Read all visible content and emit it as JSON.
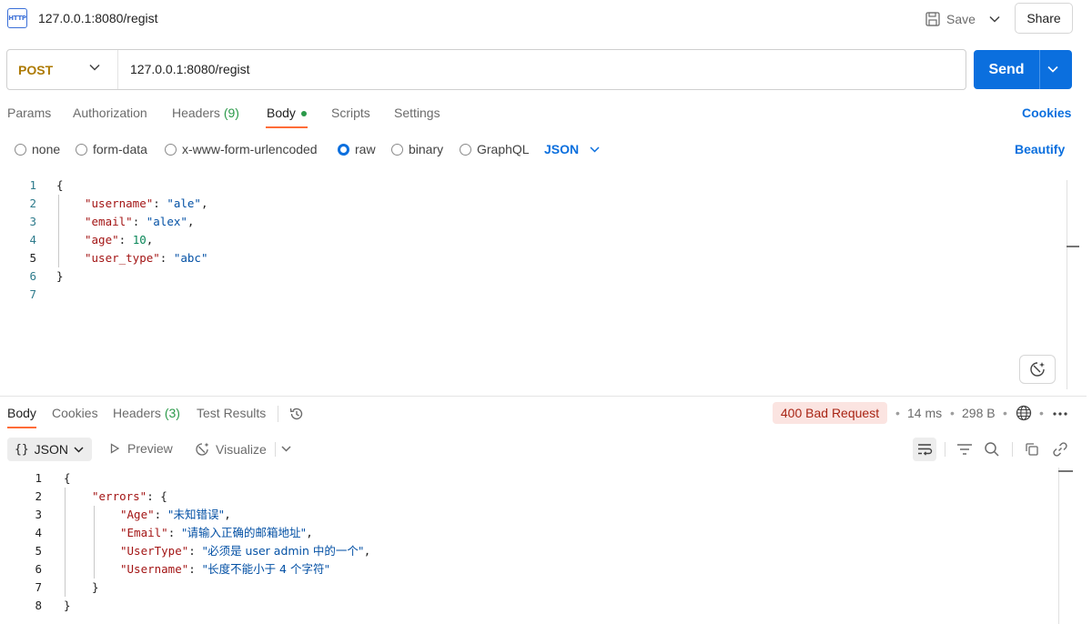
{
  "header": {
    "badge_text": "HTTP",
    "tab_title": "127.0.0.1:8080/regist",
    "save_label": "Save",
    "share_label": "Share"
  },
  "request": {
    "method": "POST",
    "url": "127.0.0.1:8080/regist",
    "send_label": "Send"
  },
  "request_tabs": {
    "params": "Params",
    "authorization": "Authorization",
    "headers": "Headers",
    "headers_count": "(9)",
    "body": "Body",
    "scripts": "Scripts",
    "settings": "Settings",
    "cookies": "Cookies"
  },
  "body_options": {
    "none": "none",
    "form_data": "form-data",
    "urlencoded": "x-www-form-urlencoded",
    "raw": "raw",
    "binary": "binary",
    "graphql": "GraphQL",
    "format": "JSON",
    "beautify": "Beautify",
    "selected": "raw"
  },
  "request_body": {
    "line_numbers": [
      "1",
      "2",
      "3",
      "4",
      "5",
      "6",
      "7"
    ],
    "open_brace": "{",
    "close_brace": "}",
    "fields": [
      {
        "key": "\"username\"",
        "value": "\"ale\"",
        "type": "string",
        "trail": ","
      },
      {
        "key": "\"email\"",
        "value": "\"alex\"",
        "type": "string",
        "trail": ","
      },
      {
        "key": "\"age\"",
        "value": "10",
        "type": "number",
        "trail": ","
      },
      {
        "key": "\"user_type\"",
        "value": "\"abc\"",
        "type": "string",
        "trail": ""
      }
    ]
  },
  "response_tabs": {
    "body": "Body",
    "cookies": "Cookies",
    "headers": "Headers",
    "headers_count": "(3)",
    "test_results": "Test Results"
  },
  "response_meta": {
    "status": "400 Bad Request",
    "time": "14 ms",
    "size": "298 B"
  },
  "response_toolbar": {
    "format": "JSON",
    "preview": "Preview",
    "visualize": "Visualize"
  },
  "response_body": {
    "line_numbers": [
      "1",
      "2",
      "3",
      "4",
      "5",
      "6",
      "7",
      "8"
    ],
    "open_brace": "{",
    "close_brace": "}",
    "errors_key": "\"errors\"",
    "errors_open": "{",
    "errors_close": "}",
    "errors": [
      {
        "key": "\"Age\"",
        "value": "\"未知错误\"",
        "trail": ","
      },
      {
        "key": "\"Email\"",
        "value": "\"请输入正确的邮箱地址\"",
        "trail": ","
      },
      {
        "key": "\"UserType\"",
        "value": "\"必须是 user admin 中的一个\"",
        "trail": ","
      },
      {
        "key": "\"Username\"",
        "value": "\"长度不能小于 4 个字符\"",
        "trail": ""
      }
    ]
  },
  "colors": {
    "accent": "#0b6fde",
    "method": "#ad7a03",
    "active_tab": "#ff6c37",
    "status_bg": "#fbe4e1",
    "status_text": "#a82414",
    "json_key": "#a31515",
    "json_string": "#0451a5",
    "json_number": "#098658"
  }
}
